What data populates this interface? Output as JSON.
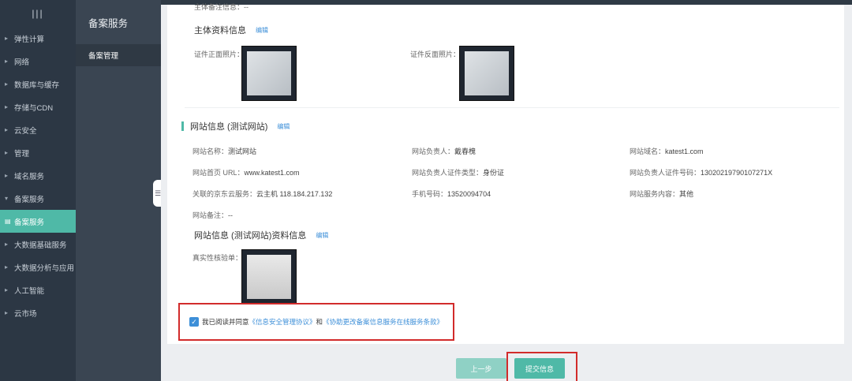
{
  "sidebar": {
    "toggle_icon": "menu-lines-icon",
    "items": [
      {
        "label": "弹性计算"
      },
      {
        "label": "网络"
      },
      {
        "label": "数据库与缓存"
      },
      {
        "label": "存储与CDN"
      },
      {
        "label": "云安全"
      },
      {
        "label": "管理"
      },
      {
        "label": "域名服务"
      },
      {
        "label": "备案服务"
      },
      {
        "label": "备案服务"
      },
      {
        "label": "大数据基础服务"
      },
      {
        "label": "大数据分析与应用"
      },
      {
        "label": "人工智能"
      },
      {
        "label": "云市场"
      }
    ]
  },
  "submenu": {
    "title": "备案服务",
    "item": "备案管理"
  },
  "main": {
    "top_cut_label": "主体备注信息：--",
    "subject_docs": {
      "title": "主体资料信息",
      "edit": "编辑",
      "front_label": "证件正面照片：",
      "back_label": "证件反面照片："
    },
    "website": {
      "title": "网站信息 (测试网站)",
      "edit": "编辑",
      "fields": [
        {
          "label": "网站名称：",
          "value": "测试网站"
        },
        {
          "label": "网站负责人：",
          "value": "戴春槐"
        },
        {
          "label": "网站域名：",
          "value": "katest1.com"
        },
        {
          "label": "网站首页 URL：",
          "value": "www.katest1.com"
        },
        {
          "label": "网站负责人证件类型：",
          "value": "身份证"
        },
        {
          "label": "网站负责人证件号码：",
          "value": "13020219790107271X"
        },
        {
          "label": "关联的京东云服务：",
          "value": "云主机 118.184.217.132"
        },
        {
          "label": "手机号码：",
          "value": "13520094704"
        },
        {
          "label": "网站服务内容：",
          "value": "其他"
        },
        {
          "label": "网站备注：",
          "value": "--"
        }
      ]
    },
    "website_docs": {
      "title": "网站信息 (测试网站)资料信息",
      "edit": "编辑",
      "check_label": "真实性核验单："
    },
    "agreement": {
      "prefix": "我已阅读并同意",
      "link1": "《信息安全管理协议》",
      "middle": "和",
      "link2": "《协助更改备案信息服务在线服务条款》"
    },
    "buttons": {
      "prev": "上一步",
      "submit": "提交信息"
    }
  }
}
